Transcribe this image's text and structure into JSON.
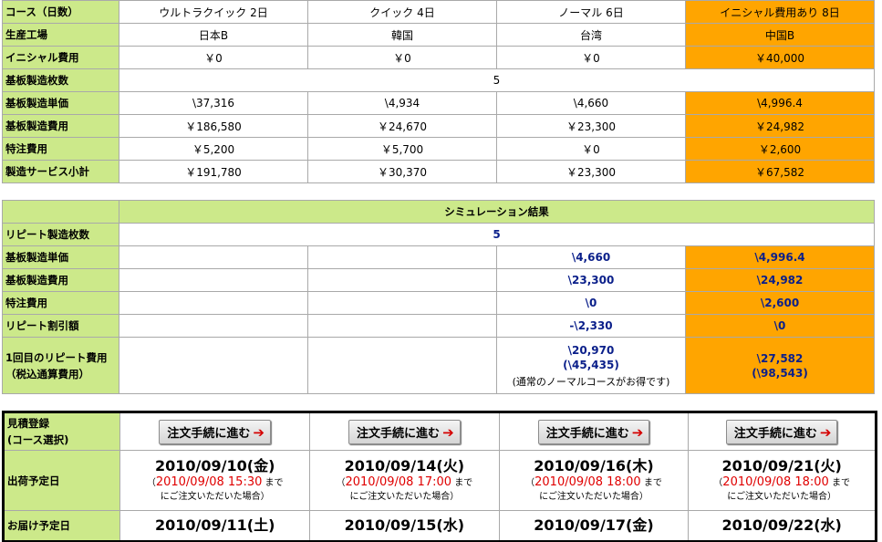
{
  "courses": {
    "header_label": "コース（日数）",
    "names": [
      "ウルトラクイック 2日",
      "クイック 4日",
      "ノーマル 6日",
      "イニシャル費用あり 8日"
    ]
  },
  "rows": [
    {
      "label": "生産工場",
      "values": [
        "日本B",
        "韓国",
        "台湾",
        "中国B"
      ]
    },
    {
      "label": "イニシャル費用",
      "values": [
        "￥0",
        "￥0",
        "￥0",
        "￥40,000"
      ]
    }
  ],
  "board_count": {
    "label": "基板製造枚数",
    "value": "5"
  },
  "cost_rows": [
    {
      "label": "基板製造単価",
      "values": [
        "\\37,316",
        "\\4,934",
        "\\4,660",
        "\\4,996.4"
      ]
    },
    {
      "label": "基板製造費用",
      "values": [
        "￥186,580",
        "￥24,670",
        "￥23,300",
        "￥24,982"
      ]
    },
    {
      "label": "特注費用",
      "values": [
        "￥5,200",
        "￥5,700",
        "￥0",
        "￥2,600"
      ]
    },
    {
      "label": "製造サービス小計",
      "values": [
        "￥191,780",
        "￥30,370",
        "￥23,300",
        "￥67,582"
      ]
    }
  ],
  "simulation": {
    "title": "シミュレーション結果",
    "repeat_count": {
      "label": "リピート製造枚数",
      "value": "5"
    },
    "rows": [
      {
        "label": "基板製造単価",
        "values": [
          "",
          "",
          "\\4,660",
          "\\4,996.4"
        ]
      },
      {
        "label": "基板製造費用",
        "values": [
          "",
          "",
          "\\23,300",
          "\\24,982"
        ]
      },
      {
        "label": "特注費用",
        "values": [
          "",
          "",
          "\\0",
          "\\2,600"
        ]
      },
      {
        "label": "リピート割引額",
        "values": [
          "",
          "",
          "-\\2,330",
          "\\0"
        ]
      }
    ],
    "first_repeat": {
      "label_line1": "1回目のリピート費用",
      "label_line2": "（税込通算費用）",
      "normal": {
        "cost": "\\20,970",
        "total": "(\\45,435)",
        "note": "(通常のノーマルコースがお得です)"
      },
      "initial": {
        "cost": "\\27,582",
        "total": "(\\98,543)"
      }
    }
  },
  "order": {
    "quote_label_line1": "見積登録",
    "quote_label_line2": "(コース選択)",
    "button_label": "注文手続に進む",
    "button_arrow": "➔",
    "ship_label": "出荷予定日",
    "deliver_label": "お届け予定日",
    "deadline_prefix": "（",
    "deadline_suffix": " まで",
    "deadline_line2": "にご注文いただいた場合）",
    "columns": [
      {
        "ship_date": "2010/09/10(金)",
        "deadline": "2010/09/08 15:30",
        "deliver_date": "2010/09/11(土)"
      },
      {
        "ship_date": "2010/09/14(火)",
        "deadline": "2010/09/08 17:00",
        "deliver_date": "2010/09/15(水)"
      },
      {
        "ship_date": "2010/09/16(木)",
        "deadline": "2010/09/08 18:00",
        "deliver_date": "2010/09/17(金)"
      },
      {
        "ship_date": "2010/09/21(火)",
        "deadline": "2010/09/08 18:00",
        "deliver_date": "2010/09/22(水)"
      }
    ]
  },
  "colors": {
    "label_bg": "#cce98a",
    "highlight": "#ffa500",
    "result_text": "#0a1f8a",
    "deadline_red": "#e00000"
  }
}
